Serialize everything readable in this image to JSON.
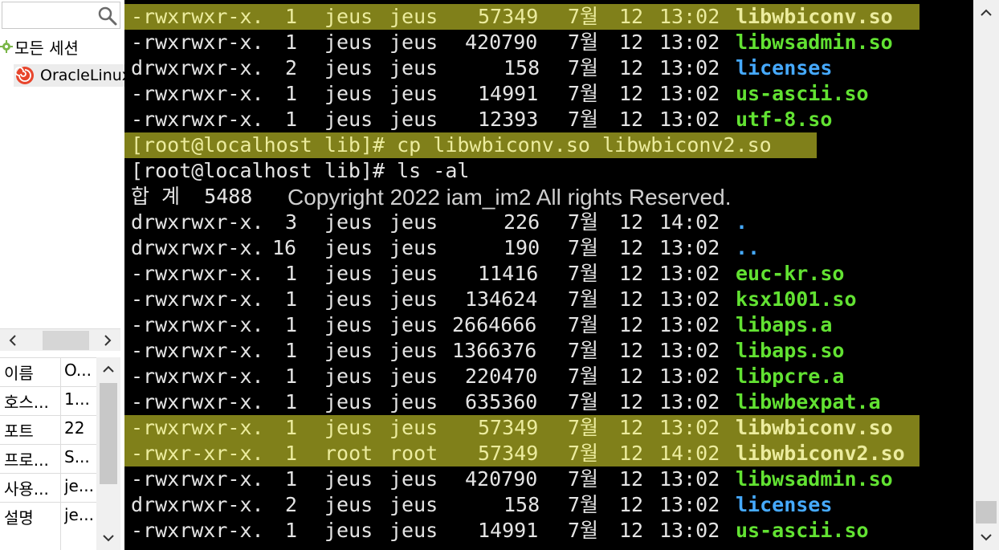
{
  "sidebar": {
    "search_placeholder": "",
    "tree_root_label": "모든 세션",
    "tree_child_label": "OracleLinux",
    "properties": [
      {
        "key": "이름",
        "value": "O..."
      },
      {
        "key": "호스...",
        "value": "1..."
      },
      {
        "key": "포트",
        "value": "22"
      },
      {
        "key": "프로...",
        "value": "S..."
      },
      {
        "key": "사용...",
        "value": "je..."
      },
      {
        "key": "설명",
        "value": "je..."
      }
    ]
  },
  "terminal": {
    "watermark": "Copyright 2022 iam_im2 All rights Reserved.",
    "lines": [
      {
        "perm": "-rwxrwxr-x.",
        "links": "1",
        "owner": "jeus",
        "group": "jeus",
        "size": "57349",
        "month": "7월",
        "day": "12",
        "time": "13:02",
        "name": "libwbiconv.so",
        "ncolor": "green",
        "highlight": true
      },
      {
        "perm": "-rwxrwxr-x.",
        "links": "1",
        "owner": "jeus",
        "group": "jeus",
        "size": "420790",
        "month": "7월",
        "day": "12",
        "time": "13:02",
        "name": "libwsadmin.so",
        "ncolor": "green",
        "highlight": false
      },
      {
        "perm": "drwxrwxr-x.",
        "links": "2",
        "owner": "jeus",
        "group": "jeus",
        "size": "158",
        "month": "7월",
        "day": "12",
        "time": "13:02",
        "name": "licenses",
        "ncolor": "blue",
        "highlight": false
      },
      {
        "perm": "-rwxrwxr-x.",
        "links": "1",
        "owner": "jeus",
        "group": "jeus",
        "size": "14991",
        "month": "7월",
        "day": "12",
        "time": "13:02",
        "name": "us-ascii.so",
        "ncolor": "green",
        "highlight": false
      },
      {
        "perm": "-rwxrwxr-x.",
        "links": "1",
        "owner": "jeus",
        "group": "jeus",
        "size": "12393",
        "month": "7월",
        "day": "12",
        "time": "13:02",
        "name": "utf-8.so",
        "ncolor": "green",
        "highlight": false
      },
      {
        "text": "[root@localhost lib]# cp libwbiconv.so libwbiconv2.so",
        "highlight": true
      },
      {
        "text": "[root@localhost lib]# ls -al",
        "highlight": false
      },
      {
        "text": "합 계  5488",
        "highlight": false
      },
      {
        "perm": "drwxrwxr-x.",
        "links": "3",
        "owner": "jeus",
        "group": "jeus",
        "size": "226",
        "month": "7월",
        "day": "12",
        "time": "14:02",
        "name": ".",
        "ncolor": "blue",
        "highlight": false
      },
      {
        "perm": "drwxrwxr-x.",
        "links": "16",
        "owner": "jeus",
        "group": "jeus",
        "size": "190",
        "month": "7월",
        "day": "12",
        "time": "13:02",
        "name": "..",
        "ncolor": "blue",
        "highlight": false
      },
      {
        "perm": "-rwxrwxr-x.",
        "links": "1",
        "owner": "jeus",
        "group": "jeus",
        "size": "11416",
        "month": "7월",
        "day": "12",
        "time": "13:02",
        "name": "euc-kr.so",
        "ncolor": "green",
        "highlight": false
      },
      {
        "perm": "-rwxrwxr-x.",
        "links": "1",
        "owner": "jeus",
        "group": "jeus",
        "size": "134624",
        "month": "7월",
        "day": "12",
        "time": "13:02",
        "name": "ksx1001.so",
        "ncolor": "green",
        "highlight": false
      },
      {
        "perm": "-rwxrwxr-x.",
        "links": "1",
        "owner": "jeus",
        "group": "jeus",
        "size": "2664666",
        "month": "7월",
        "day": "12",
        "time": "13:02",
        "name": "libaps.a",
        "ncolor": "green",
        "highlight": false
      },
      {
        "perm": "-rwxrwxr-x.",
        "links": "1",
        "owner": "jeus",
        "group": "jeus",
        "size": "1366376",
        "month": "7월",
        "day": "12",
        "time": "13:02",
        "name": "libaps.so",
        "ncolor": "green",
        "highlight": false
      },
      {
        "perm": "-rwxrwxr-x.",
        "links": "1",
        "owner": "jeus",
        "group": "jeus",
        "size": "220470",
        "month": "7월",
        "day": "12",
        "time": "13:02",
        "name": "libpcre.a",
        "ncolor": "green",
        "highlight": false
      },
      {
        "perm": "-rwxrwxr-x.",
        "links": "1",
        "owner": "jeus",
        "group": "jeus",
        "size": "635360",
        "month": "7월",
        "day": "12",
        "time": "13:02",
        "name": "libwbexpat.a",
        "ncolor": "green",
        "highlight": false
      },
      {
        "perm": "-rwxrwxr-x.",
        "links": "1",
        "owner": "jeus",
        "group": "jeus",
        "size": "57349",
        "month": "7월",
        "day": "12",
        "time": "13:02",
        "name": "libwbiconv.so",
        "ncolor": "green",
        "highlight": true
      },
      {
        "perm": "-rwxr-xr-x.",
        "links": "1",
        "owner": "root",
        "group": "root",
        "size": "57349",
        "month": "7월",
        "day": "12",
        "time": "14:02",
        "name": "libwbiconv2.so",
        "ncolor": "green",
        "highlight": true
      },
      {
        "perm": "-rwxrwxr-x.",
        "links": "1",
        "owner": "jeus",
        "group": "jeus",
        "size": "420790",
        "month": "7월",
        "day": "12",
        "time": "13:02",
        "name": "libwsadmin.so",
        "ncolor": "green",
        "highlight": false
      },
      {
        "perm": "drwxrwxr-x.",
        "links": "2",
        "owner": "jeus",
        "group": "jeus",
        "size": "158",
        "month": "7월",
        "day": "12",
        "time": "13:02",
        "name": "licenses",
        "ncolor": "blue",
        "highlight": false
      },
      {
        "perm": "-rwxrwxr-x.",
        "links": "1",
        "owner": "jeus",
        "group": "jeus",
        "size": "14991",
        "month": "7월",
        "day": "12",
        "time": "13:02",
        "name": "us-ascii.so",
        "ncolor": "green",
        "highlight": false
      }
    ]
  },
  "colors": {
    "terminal_bg": "#000000",
    "text": "#e4e4e4",
    "highlight_bg": "#80801a",
    "highlight_text": "#ecec9e",
    "exec_file": "#62e232",
    "directory": "#46aaff"
  },
  "icons": {
    "search": "search-icon",
    "tree_root": "gear-icon",
    "session": "swirl-session-icon"
  }
}
